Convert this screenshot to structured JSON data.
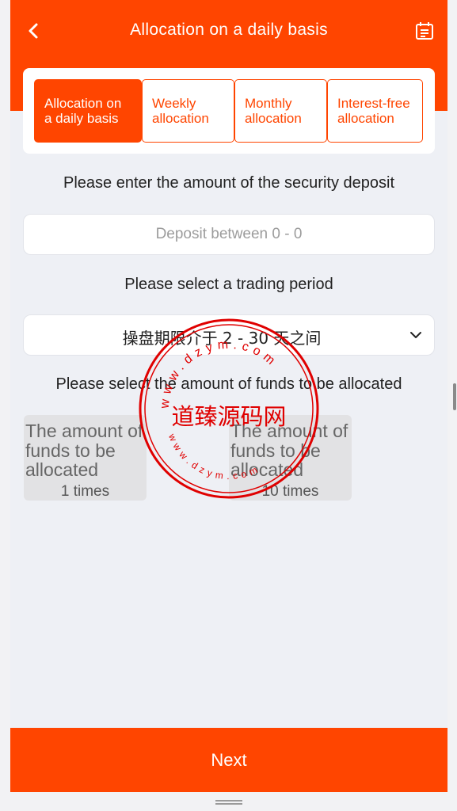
{
  "header": {
    "title": "Allocation on a daily basis",
    "back_icon": "chevron-left-icon",
    "calendar_icon": "calendar-list-icon"
  },
  "tabs": [
    {
      "label": "Allocation on a daily basis",
      "active": true
    },
    {
      "label": "Weekly allocation",
      "active": false
    },
    {
      "label": "Monthly allocation",
      "active": false
    },
    {
      "label": "Interest-free allocation",
      "active": false
    }
  ],
  "deposit": {
    "label": "Please enter the amount of the security deposit",
    "placeholder": "Deposit between 0 - 0",
    "value": ""
  },
  "period": {
    "label": "Please select a trading period",
    "selected": "操盘期限介于 2 - 30 天之间",
    "chevron_icon": "chevron-down-icon"
  },
  "funds": {
    "label": "Please select the amount of funds to be allocated",
    "options": [
      {
        "title": "The amount of funds to be allocated",
        "times": "1 times"
      },
      {
        "title": "The amount of funds to be allocated",
        "times": "10 times"
      }
    ]
  },
  "next_label": "Next",
  "watermark": {
    "text": "道臻源码网",
    "ring_text": "www.dzym.com",
    "ring_text_bottom": "www.dzym.com"
  },
  "colors": {
    "accent": "#ff4500",
    "background": "#eef0f5",
    "card": "#ffffff",
    "fund_card": "#e2e2e4",
    "stamp": "#e00000"
  }
}
